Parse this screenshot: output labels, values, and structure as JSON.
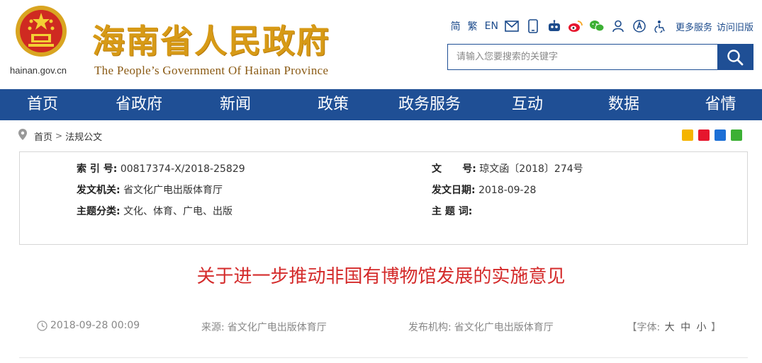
{
  "site": {
    "domain": "hainan.gov.cn",
    "title_cn": "海南省人民政府",
    "title_en": "The People’s Government Of Hainan Province"
  },
  "toolbar": {
    "simplified": "简",
    "traditional": "繁",
    "english": "EN",
    "icons": [
      "mail-icon",
      "mobile-icon",
      "robot-icon",
      "weibo-icon",
      "wechat-icon",
      "user-icon",
      "accessibility-icon",
      "elder-mode-icon"
    ],
    "more_services": "更多服务",
    "old_version": "访问旧版"
  },
  "search": {
    "placeholder": "请输入您要搜索的关键字"
  },
  "nav": [
    "首页",
    "省政府",
    "新闻",
    "政策",
    "政务服务",
    "互动",
    "数据",
    "省情"
  ],
  "breadcrumb": {
    "home": "首页",
    "current": "法规公文"
  },
  "info": {
    "index_label": "索 引 号:",
    "index_value": "00817374-X/2018-25829",
    "doc_no_label": "文      号:",
    "doc_no_value": "琼文函〔2018〕274号",
    "issuer_label": "发文机关:",
    "issuer_value": "省文化广电出版体育厅",
    "date_label": "发文日期:",
    "date_value": "2018-09-28",
    "topic_label": "主题分类:",
    "topic_value": "文化、体育、广电、出版",
    "keywords_label": "主 题 词:",
    "keywords_value": ""
  },
  "article": {
    "title": "关于进一步推动非国有博物馆发展的实施意见",
    "datetime": "2018-09-28 00:09",
    "source_label": "来源:",
    "source_value": "省文化广电出版体育厅",
    "publisher_label": "发布机构:",
    "publisher_value": "省文化广电出版体育厅",
    "font_open": "【字体:",
    "font_large": "大",
    "font_medium": "中",
    "font_small": "小",
    "font_close": "】"
  },
  "colors": {
    "nav_blue": "#1f4f95",
    "title_red": "#d42b2b",
    "logo_gold": "#d79a16"
  }
}
